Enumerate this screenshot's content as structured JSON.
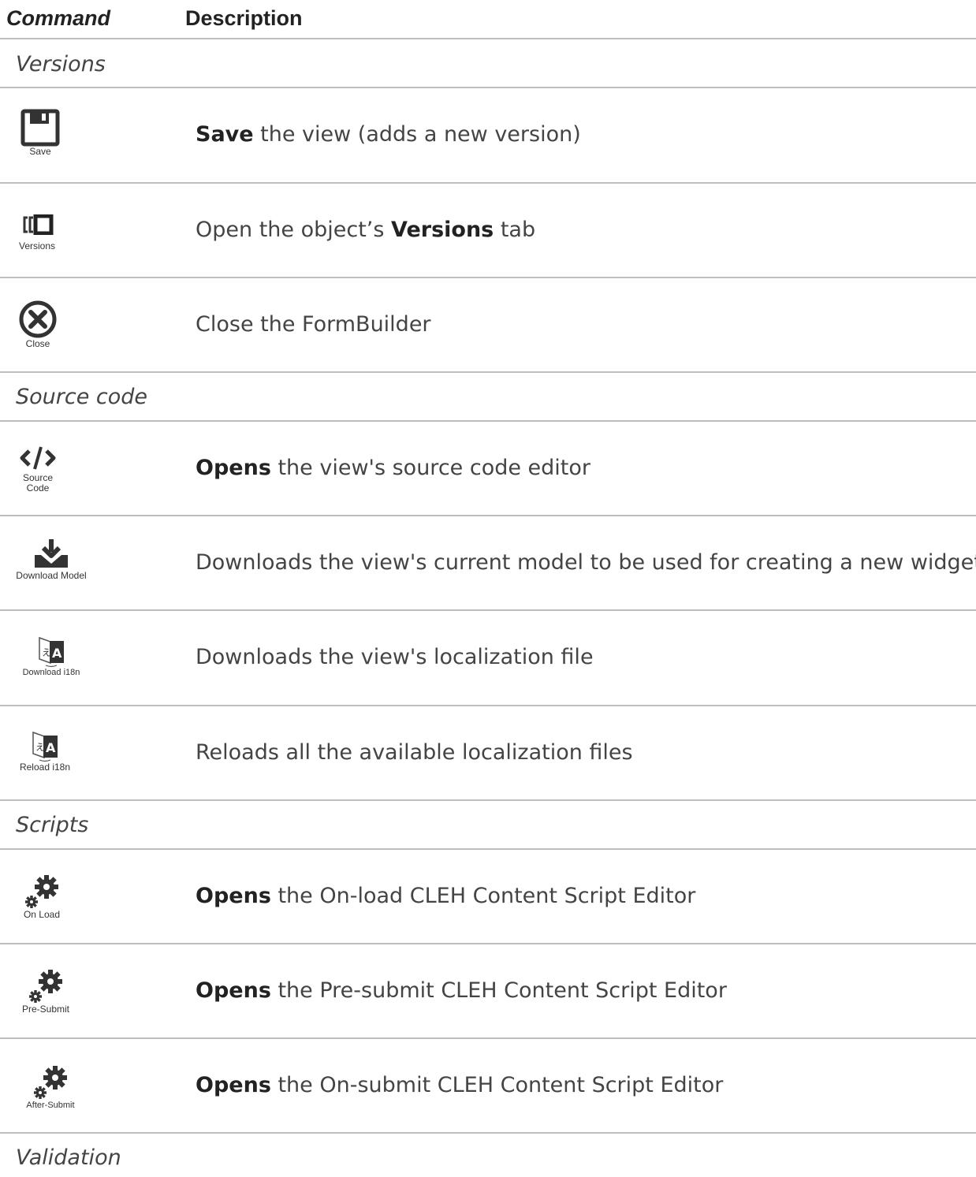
{
  "header": {
    "command": "Command",
    "description": "Description"
  },
  "sections": {
    "versions": "Versions",
    "source_code": "Source code",
    "scripts": "Scripts",
    "validation": "Validation"
  },
  "rows": {
    "save": {
      "caption": "Save",
      "bold": "Save",
      "text": " the view (adds a new version)",
      "icon": "floppy-disk-icon"
    },
    "versions": {
      "caption": "Versions",
      "pre": "Open the object’s ",
      "bold": "Versions",
      "text": " tab",
      "icon": "versions-icon"
    },
    "close": {
      "caption": "Close",
      "text": "Close the FormBuilder",
      "icon": "close-circle-icon"
    },
    "source": {
      "caption1": "Source",
      "caption2": "Code",
      "bold": "Opens",
      "text": " the view's source code editor",
      "icon": "code-icon"
    },
    "download_model": {
      "caption": "Download Model",
      "text": "Downloads the view's current model to be used for creating a new widget",
      "icon": "download-icon"
    },
    "download_i18n": {
      "caption": "Download i18n",
      "text": "Downloads the view's localization file",
      "icon": "translate-icon"
    },
    "reload_i18n": {
      "caption": "Reload i18n",
      "text": "Reloads all the available localization files",
      "icon": "translate-icon"
    },
    "on_load": {
      "caption": "On Load",
      "bold": "Opens",
      "text": " the On-load CLEH Content Script Editor",
      "icon": "gears-icon"
    },
    "pre_submit": {
      "caption": "Pre-Submit",
      "bold": "Opens",
      "text": " the Pre-submit CLEH Content Script Editor",
      "icon": "gears-icon"
    },
    "after_submit": {
      "caption": "After-Submit",
      "bold": "Opens",
      "text": " the On-submit CLEH Content Script Editor",
      "icon": "gears-icon"
    }
  }
}
